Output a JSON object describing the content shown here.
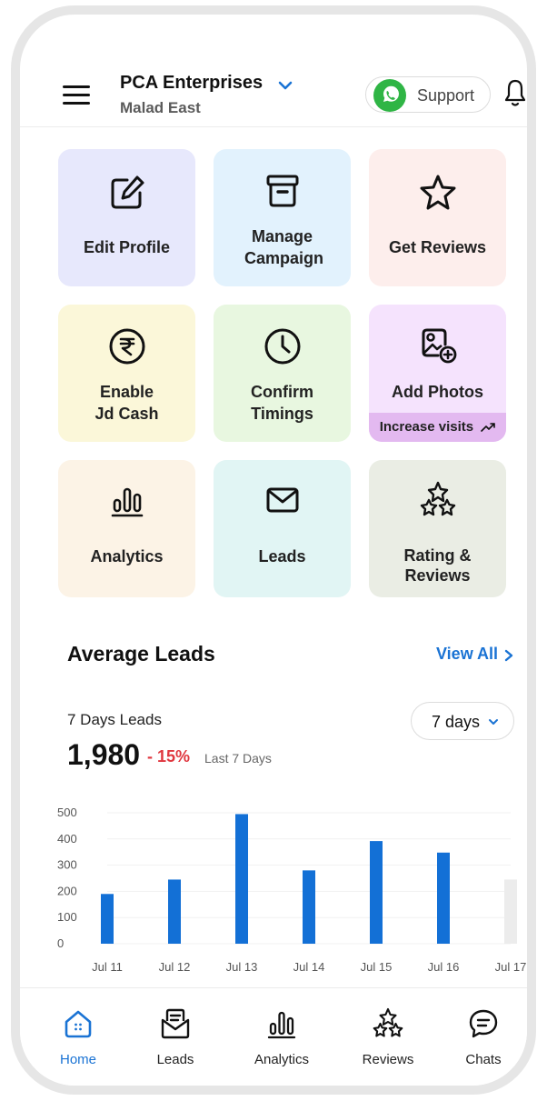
{
  "header": {
    "business_name": "PCA Enterprises",
    "location": "Malad East",
    "support_label": "Support"
  },
  "tiles": [
    {
      "label": "Edit Profile",
      "bg": "#e7e8fc",
      "icon": "edit-icon"
    },
    {
      "label": "Manage Campaign",
      "bg": "#e2f2fd",
      "icon": "archive-box-icon"
    },
    {
      "label": "Get Reviews",
      "bg": "#fdeeec",
      "icon": "star-icon"
    },
    {
      "label": "Enable Jd Cash",
      "bg": "#fbf7d9",
      "icon": "rupee-icon"
    },
    {
      "label": "Confirm Timings",
      "bg": "#e8f7e0",
      "icon": "clock-icon"
    },
    {
      "label": "Add Photos",
      "sub_label": "Increase visits",
      "bg": "#f5e3fd",
      "icon": "add-photo-icon"
    },
    {
      "label": "Analytics",
      "bg": "#fcf3e6",
      "icon": "analytics-icon"
    },
    {
      "label": "Leads",
      "bg": "#e1f5f4",
      "icon": "mail-icon"
    },
    {
      "label": "Rating & Reviews",
      "bg": "#eaede4",
      "icon": "stars-icon"
    }
  ],
  "average_leads": {
    "title": "Average Leads",
    "view_all": "View All",
    "leads_label": "7 Days Leads",
    "range_selected": "7 days",
    "value": "1,980",
    "change": "- 15%",
    "period": "Last 7 Days"
  },
  "chart_data": {
    "type": "bar",
    "categories": [
      "Jul 11",
      "Jul 12",
      "Jul 13",
      "Jul 14",
      "Jul 15",
      "Jul 16",
      "Jul 17"
    ],
    "values": [
      190,
      245,
      495,
      280,
      392,
      348,
      245
    ],
    "bar_colors": [
      "#1370d6",
      "#1370d6",
      "#1370d6",
      "#1370d6",
      "#1370d6",
      "#1370d6",
      "#ececec"
    ],
    "yticks": [
      0,
      100,
      200,
      300,
      400,
      500
    ],
    "ylim": [
      0,
      500
    ],
    "grid": true
  },
  "nav": [
    {
      "label": "Home",
      "icon": "home-icon",
      "active": true
    },
    {
      "label": "Leads",
      "icon": "leads-inbox-icon",
      "active": false
    },
    {
      "label": "Analytics",
      "icon": "analytics-icon",
      "active": false
    },
    {
      "label": "Reviews",
      "icon": "stars-icon",
      "active": false
    },
    {
      "label": "Chats",
      "icon": "chat-icon",
      "active": false
    }
  ],
  "colors": {
    "accent": "#1a73d4",
    "negative": "#e0373f",
    "whatsapp": "#2fb545"
  }
}
